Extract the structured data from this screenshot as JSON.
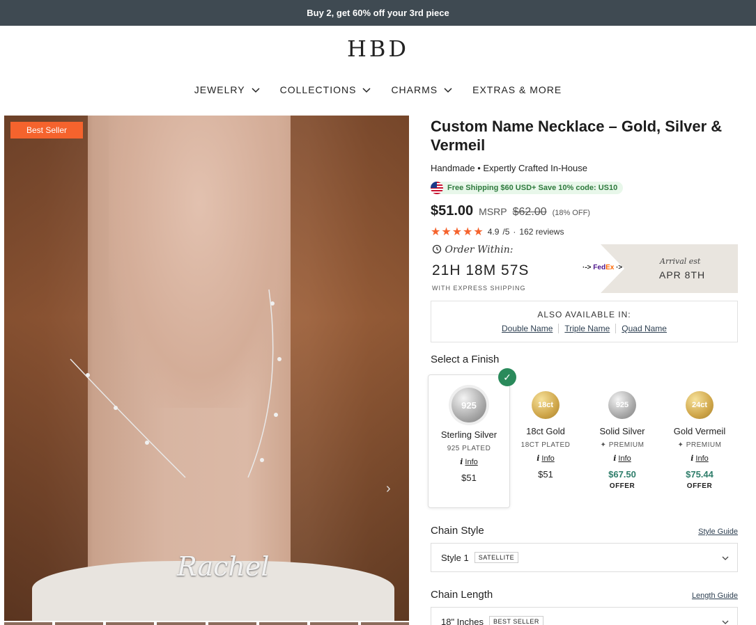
{
  "promo": "Buy 2, get 60% off your 3rd piece",
  "brand": "HBD",
  "nav": [
    {
      "label": "JEWELRY",
      "dropdown": true
    },
    {
      "label": "COLLECTIONS",
      "dropdown": true
    },
    {
      "label": "CHARMS",
      "dropdown": true
    },
    {
      "label": "EXTRAS & MORE",
      "dropdown": false
    }
  ],
  "gallery": {
    "badge": "Best Seller",
    "pendant_text": "Rachel",
    "next_icon": "›"
  },
  "product": {
    "title": "Custom Name Necklace – Gold, Silver & Vermeil",
    "subtitle": "Handmade • Expertly Crafted In-House",
    "shipping": "Free Shipping $60 USD+ Save 10% code: US10",
    "price": "$51.00",
    "msrp_label": "MSRP",
    "old_price": "$62.00",
    "discount": "(18% OFF)",
    "stars": "★★★★★",
    "rating": "4.9",
    "rating_max": "/5",
    "separator": "·",
    "reviews": "162 reviews"
  },
  "delivery": {
    "order_label": "Order Within:",
    "countdown": "21H 18M 57S",
    "express": "WITH EXPRESS SHIPPING",
    "carrier_fed": "Fed",
    "carrier_ex": "Ex",
    "arrival_label": "Arrival est",
    "arrival_date": "APR 8TH"
  },
  "also_available": {
    "title": "ALSO AVAILABLE IN:",
    "links": [
      "Double Name",
      "Triple Name",
      "Quad Name"
    ]
  },
  "finish": {
    "label": "Select a Finish",
    "options": [
      {
        "coin": "925",
        "name": "Sterling Silver",
        "sub": "925 PLATED",
        "info": "Info",
        "price": "$51",
        "offer": ""
      },
      {
        "coin": "18ct",
        "name": "18ct Gold",
        "sub": "18CT PLATED",
        "info": "Info",
        "price": "$51",
        "offer": ""
      },
      {
        "coin": "925",
        "name": "Solid Silver",
        "sub": "PREMIUM",
        "info": "Info",
        "price": "$67.50",
        "offer": "OFFER"
      },
      {
        "coin": "24ct",
        "name": "Gold Vermeil",
        "sub": "PREMIUM",
        "info": "Info",
        "price": "$75.44",
        "offer": "OFFER"
      }
    ]
  },
  "chain_style": {
    "label": "Chain Style",
    "guide": "Style Guide",
    "value": "Style 1",
    "tag": "SATELLITE"
  },
  "chain_length": {
    "label": "Chain Length",
    "guide": "Length Guide",
    "value": "18\" Inches",
    "tag": "BEST SELLER"
  },
  "colors": {
    "promo_bg": "#3f4a52",
    "accent": "#f5632d",
    "check": "#2a8a5b",
    "shipping_green": "#2e7a3d",
    "offer": "#2e7d6a"
  }
}
